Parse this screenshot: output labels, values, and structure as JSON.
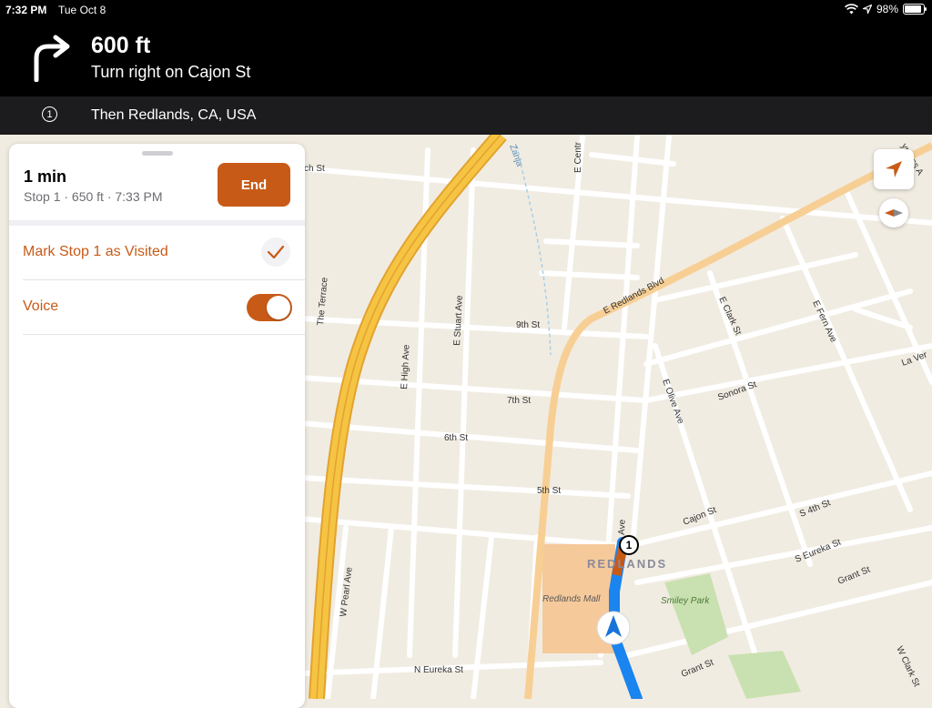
{
  "status_bar": {
    "time": "7:32 PM",
    "date": "Tue Oct 8",
    "battery": "98%"
  },
  "nav": {
    "distance": "600 ft",
    "instruction": "Turn right on Cajon St",
    "turn_icon": "turn-right-arrow-icon"
  },
  "next": {
    "badge": "1",
    "text": "Then Redlands, CA, USA"
  },
  "panel": {
    "eta": "1 min",
    "details": "Stop 1  ·  650 ft  ·  7:33 PM",
    "end_label": "End",
    "mark_visited_label": "Mark Stop 1 as Visited",
    "voice_label": "Voice",
    "voice_on": true
  },
  "map": {
    "streets": [
      "ch St",
      "Zanja",
      "E Centr",
      "ypress A",
      "The Terrace",
      "E Stuart Ave",
      "9th St",
      "E Redlands Blvd",
      "E Clark St",
      "E Fern Ave",
      "E High Ave",
      "7th St",
      "E Olive Ave",
      "Sonora St",
      "La Ver",
      "6th St",
      "5th St",
      "Cajon St",
      "S 4th St",
      "Ave",
      "W Pearl Ave",
      "S Eureka St",
      "Grant St",
      "N Eureka St",
      "Grant St",
      "W Clark St"
    ],
    "place_labels": {
      "city": "REDLANDS",
      "mall": "Redlands Mall",
      "park": "Smiley Park"
    },
    "stop_marker": "1",
    "colors": {
      "route": "#1a84ef",
      "route_end": "#c85a17",
      "freeway": "#f6c443",
      "accent": "#c85a17"
    }
  }
}
